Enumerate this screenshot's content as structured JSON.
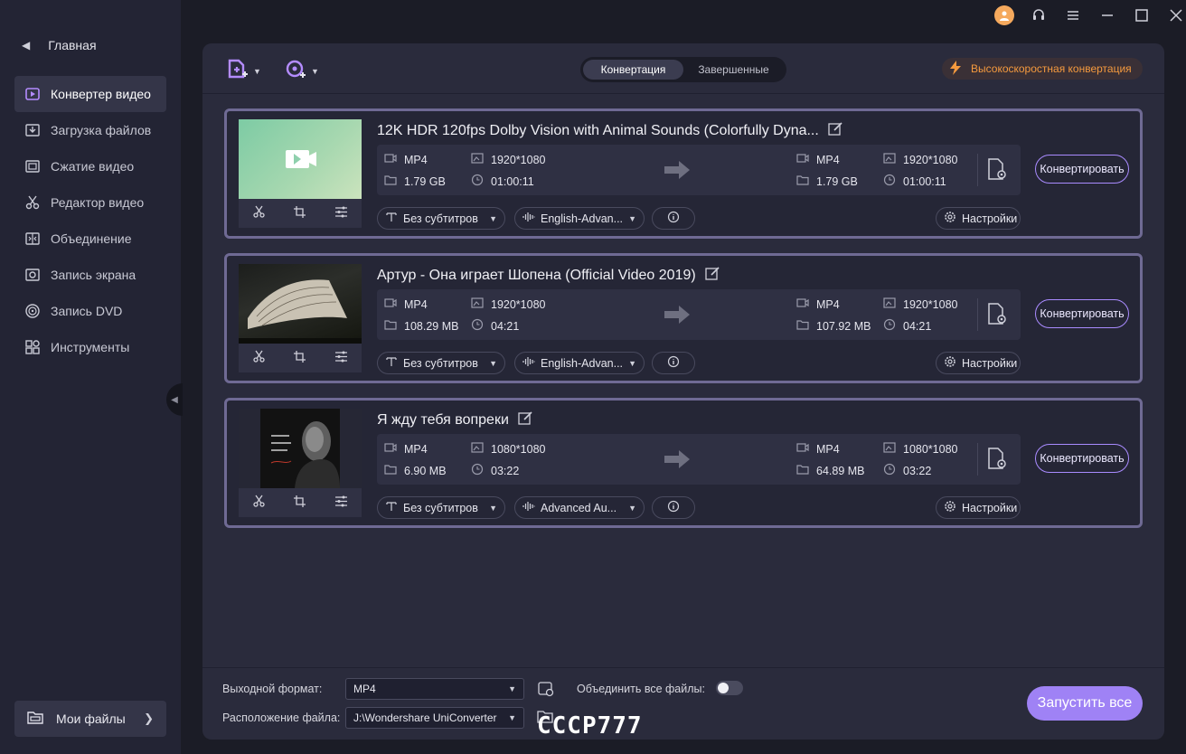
{
  "sidebar": {
    "home_label": "Главная",
    "items": [
      {
        "label": "Конвертер видео",
        "icon": "video-converter-icon",
        "active": true
      },
      {
        "label": "Загрузка файлов",
        "icon": "download-icon"
      },
      {
        "label": "Сжатие видео",
        "icon": "compress-icon"
      },
      {
        "label": "Редактор видео",
        "icon": "scissors-icon"
      },
      {
        "label": "Объединение",
        "icon": "merge-icon"
      },
      {
        "label": "Запись экрана",
        "icon": "screen-record-icon"
      },
      {
        "label": "Запись DVD",
        "icon": "dvd-icon"
      },
      {
        "label": "Инструменты",
        "icon": "toolbox-icon"
      }
    ],
    "my_files_label": "Мои файлы"
  },
  "topbar": {
    "tabs": [
      "Конвертация",
      "Завершенные"
    ],
    "active_tab": 0,
    "high_speed_label": "Высокоскоростная конвертация"
  },
  "files": [
    {
      "title": "12K HDR 120fps Dolby Vision with Animal Sounds (Colorfully Dyna...",
      "src": {
        "format": "MP4",
        "resolution": "1920*1080",
        "size": "1.79 GB",
        "duration": "01:00:11"
      },
      "dst": {
        "format": "MP4",
        "resolution": "1920*1080",
        "size": "1.79 GB",
        "duration": "01:00:11"
      },
      "subtitle": "Без субтитров",
      "audio": "English-Advan...",
      "settings_label": "Настройки",
      "convert_label": "Конвертировать"
    },
    {
      "title": "Артур - Она играет Шопена (Official Video 2019)",
      "src": {
        "format": "MP4",
        "resolution": "1920*1080",
        "size": "108.29 MB",
        "duration": "04:21"
      },
      "dst": {
        "format": "MP4",
        "resolution": "1920*1080",
        "size": "107.92 MB",
        "duration": "04:21"
      },
      "subtitle": "Без субтитров",
      "audio": "English-Advan...",
      "settings_label": "Настройки",
      "convert_label": "Конвертировать"
    },
    {
      "title": "Я жду тебя вопреки",
      "src": {
        "format": "MP4",
        "resolution": "1080*1080",
        "size": "6.90 MB",
        "duration": "03:22"
      },
      "dst": {
        "format": "MP4",
        "resolution": "1080*1080",
        "size": "64.89 MB",
        "duration": "03:22"
      },
      "subtitle": "Без субтитров",
      "audio": "Advanced Au...",
      "settings_label": "Настройки",
      "convert_label": "Конвертировать"
    }
  ],
  "bottom": {
    "output_format_label": "Выходной формат:",
    "output_format_value": "MP4",
    "merge_label": "Объединить все файлы:",
    "location_label": "Расположение файла:",
    "location_value": "J:\\Wondershare UniConverter",
    "start_all_label": "Запустить все"
  },
  "watermark": "СССР777"
}
